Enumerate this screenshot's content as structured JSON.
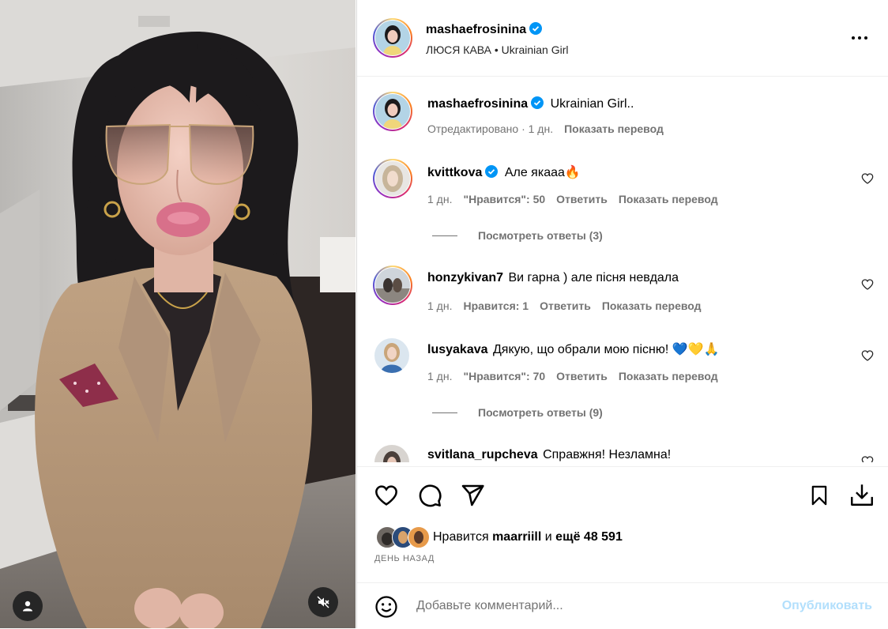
{
  "post": {
    "author": "mashaefrosinina",
    "audio": "ЛЮСЯ КАВА • Ukrainian Girl",
    "caption": "Ukrainian Girl..",
    "edited": "Отредактировано · 1 дн.",
    "translate": "Показать перевод"
  },
  "comments": [
    {
      "user": "kvittkova",
      "text": "Але якааа🔥",
      "time": "1 дн.",
      "likes": "\"Нравится\": 50",
      "reply": "Ответить",
      "translate": "Показать перевод",
      "view_replies": "Посмотреть ответы (3)"
    },
    {
      "user": "honzykivan7",
      "text": "Ви гарна ) але пісня невдала",
      "time": "1 дн.",
      "likes": "Нравится: 1",
      "reply": "Ответить",
      "translate": "Показать перевод"
    },
    {
      "user": "lusyakava",
      "text": "Дякую, що обрали мою пісню! 💙💛🙏",
      "time": "1 дн.",
      "likes": "\"Нравится\": 70",
      "reply": "Ответить",
      "translate": "Показать перевод",
      "view_replies": "Посмотреть ответы (9)"
    },
    {
      "user": "svitlana_rupcheva",
      "text": "Справжня! Незламна!"
    }
  ],
  "likes_line": {
    "prefix": "Нравится",
    "user": "maarriill",
    "middle": "и",
    "rest": "ещё 48 591"
  },
  "date": "ДЕНЬ НАЗАД",
  "add_comment": {
    "placeholder": "Добавьте комментарий...",
    "publish": "Опубликовать"
  },
  "colors": {
    "verified": "#0095f6",
    "muted": "#737373",
    "publish": "#b2dffc"
  },
  "icons": [
    "more-icon",
    "heart-icon",
    "comment-icon",
    "share-icon",
    "bookmark-icon",
    "download-icon",
    "emoji-icon",
    "user-tag-icon",
    "mute-icon"
  ]
}
